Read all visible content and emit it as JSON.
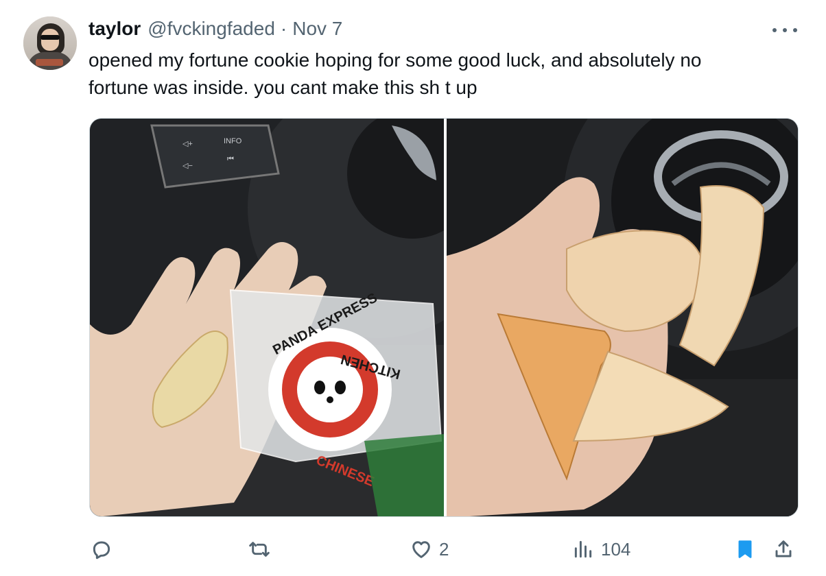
{
  "tweet": {
    "display_name": "taylor",
    "handle": "@fvckingfaded",
    "separator": "·",
    "date": "Nov 7",
    "text": "opened my fortune cookie hoping for some good luck, and absolutely no\nfortune was inside. you cant make this sh t up"
  },
  "media": {
    "left_image": {
      "icon": "photo-hand-cookie-wrapper",
      "wrapper_text_top": "PANDA EXPRESS",
      "wrapper_text_right": "KITCHEN",
      "wrapper_text_bottom": "CHINESE"
    },
    "right_image": {
      "icon": "photo-broken-fortune-cookie"
    },
    "car_buttons": {
      "info": "INFO"
    }
  },
  "actions": {
    "reply": {
      "icon": "reply-icon",
      "count": ""
    },
    "repost": {
      "icon": "repost-icon",
      "count": ""
    },
    "like": {
      "icon": "heart-icon",
      "count": "2"
    },
    "views": {
      "icon": "views-icon",
      "count": "104"
    },
    "bookmark": {
      "icon": "bookmark-icon",
      "active": true
    },
    "share": {
      "icon": "share-icon"
    }
  },
  "colors": {
    "text": "#0f1419",
    "secondary": "#536471",
    "accent": "#1d9bf0",
    "border": "#cfd9de"
  }
}
